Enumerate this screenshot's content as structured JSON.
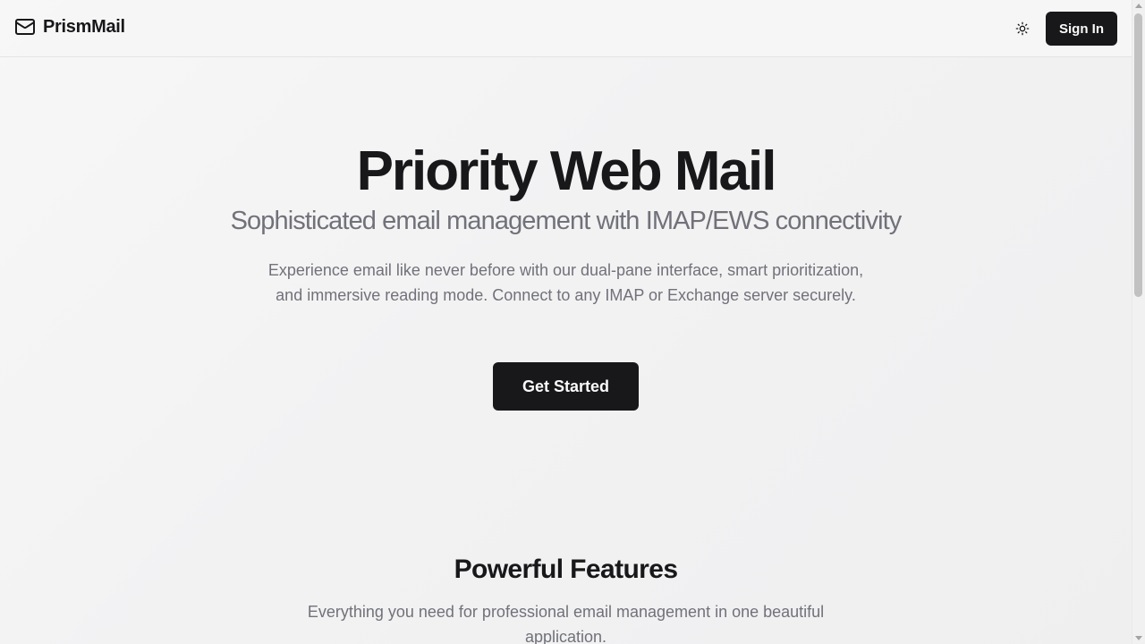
{
  "header": {
    "brand_name": "PrismMail",
    "brand_icon": "mail-icon",
    "theme_icon": "sun-icon",
    "sign_in_label": "Sign In"
  },
  "hero": {
    "title": "Priority Web Mail",
    "subtitle": "Sophisticated email management with IMAP/EWS connectivity",
    "description": "Experience email like never before with our dual-pane interface, smart prioritization, and immersive reading mode. Connect to any IMAP or Exchange server securely.",
    "cta_label": "Get Started"
  },
  "features": {
    "title": "Powerful Features",
    "description": "Everything you need for professional email management in one beautiful application."
  },
  "colors": {
    "primary": "#18181b",
    "muted_text": "#71717a",
    "background": "#f4f4f4"
  },
  "scroll": {
    "visible_fraction": 0.46
  }
}
